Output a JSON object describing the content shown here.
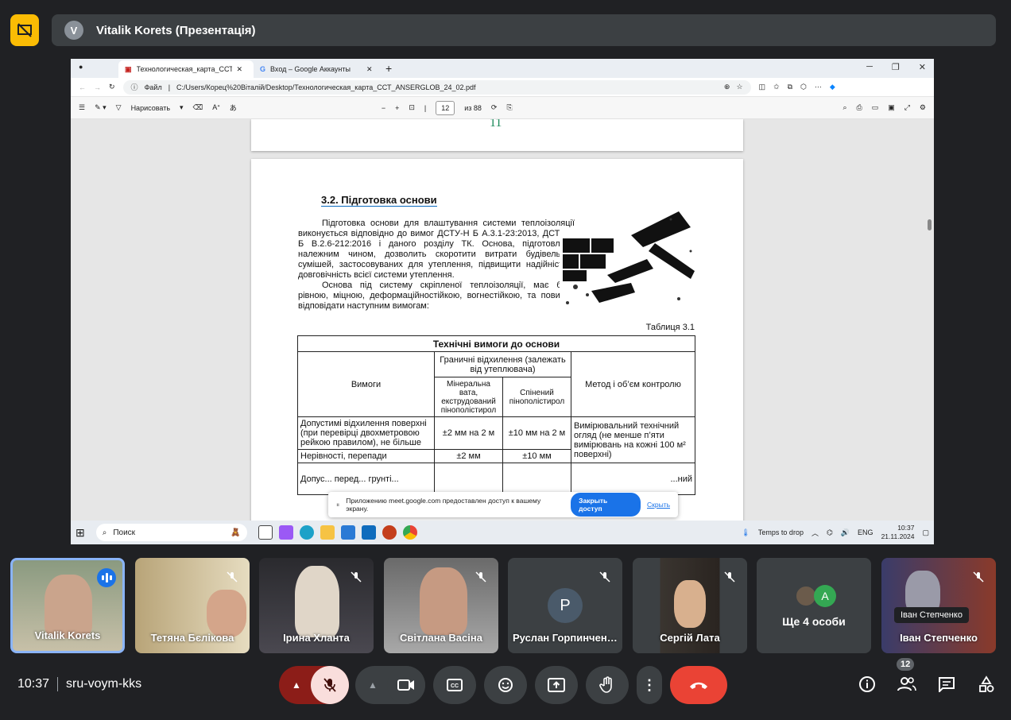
{
  "presenter": {
    "initial": "V",
    "title": "Vitalik Korets (Презентація)"
  },
  "browser": {
    "tabs": [
      {
        "label": "Технологическая_карта_ССТ_ANSE"
      },
      {
        "label": "Вход – Google Аккаунты"
      }
    ],
    "address": {
      "prefix": "Файл",
      "url": "C:/Users/Корец%20Віталій/Desktop/Технологическая_карта_ССТ_ANSERGLOB_24_02.pdf"
    },
    "pdf_toolbar": {
      "draw_label": "Нарисовать",
      "page_value": "12",
      "page_total": "из 88"
    }
  },
  "pdf": {
    "prev_page_number": "11",
    "section_title": "3.2. Підготовка основи",
    "paragraph1": "Підготовка основи для влаштування системи теплоізоляції виконується відповідно до вимог ДСТУ-Н Б А.3.1-23:2013, ДСТУ-Н Б В.2.6-212:2016 і даного розділу ТК. Основа, підготовлена належним чином, дозволить скоротити витрати будівельних сумішей, застосовуваних для утеплення, підвищити надійність і довговічність всієї системи утеплення.",
    "paragraph2": "Основа під систему скріпленої теплоізоляції, має бути рівною, міцною, деформаційностійкою, вогнестійкою, та повинна відповідати наступним вимогам:",
    "table_caption": "Таблиця 3.1",
    "table": {
      "title": "Технічні вимоги до основи",
      "col_requirements": "Вимоги",
      "col_deviation": "Граничні відхилення (залежать від утеплювача)",
      "col_mineral": "Мінеральна вата, екструдований пінополістирол",
      "col_foam": "Спінений пінополістирол",
      "col_method": "Метод і об’єм контролю",
      "row1_req": "Допустимі відхилення поверхні (при перевірці двохметровою рейкою правилом), не більше",
      "row1_mineral": "±2 мм на 2 м",
      "row1_foam": "±10 мм на 2 м",
      "row1_method": "Вимірювальний технічний огляд (не менше п’яти вимірювань на кожні 100 м² поверхні)",
      "row2_req": "Нерівності, перепади",
      "row2_mineral": "±2 мм",
      "row2_foam": "±10 мм",
      "row3_req": "Допус... перед... грунті...",
      "row3_method": "...ний"
    }
  },
  "share_toast": {
    "text": "Приложению meet.google.com предоставлен доступ к вашему экрану.",
    "button": "Закрыть доступ",
    "hide": "Скрыть"
  },
  "taskbar": {
    "search_placeholder": "Поиск",
    "weather": "Temps to drop",
    "lang": "ENG",
    "time": "10:37",
    "date": "21.11.2024"
  },
  "participants": [
    {
      "name": "Vitalik Korets"
    },
    {
      "name": "Тетяна Бєлікова"
    },
    {
      "name": "Ірина Хланта"
    },
    {
      "name": "Світлана Васіна"
    },
    {
      "name": "Руслан Горпинченко",
      "initial": "P"
    },
    {
      "name": "Сергій Лата"
    },
    {
      "name": "Ще 4 особи",
      "initial": "A"
    },
    {
      "name": "Іван Степченко",
      "tooltip": "Іван Степченко"
    }
  ],
  "meeting": {
    "time": "10:37",
    "code": "sru-voym-kks",
    "people_count": "12"
  }
}
